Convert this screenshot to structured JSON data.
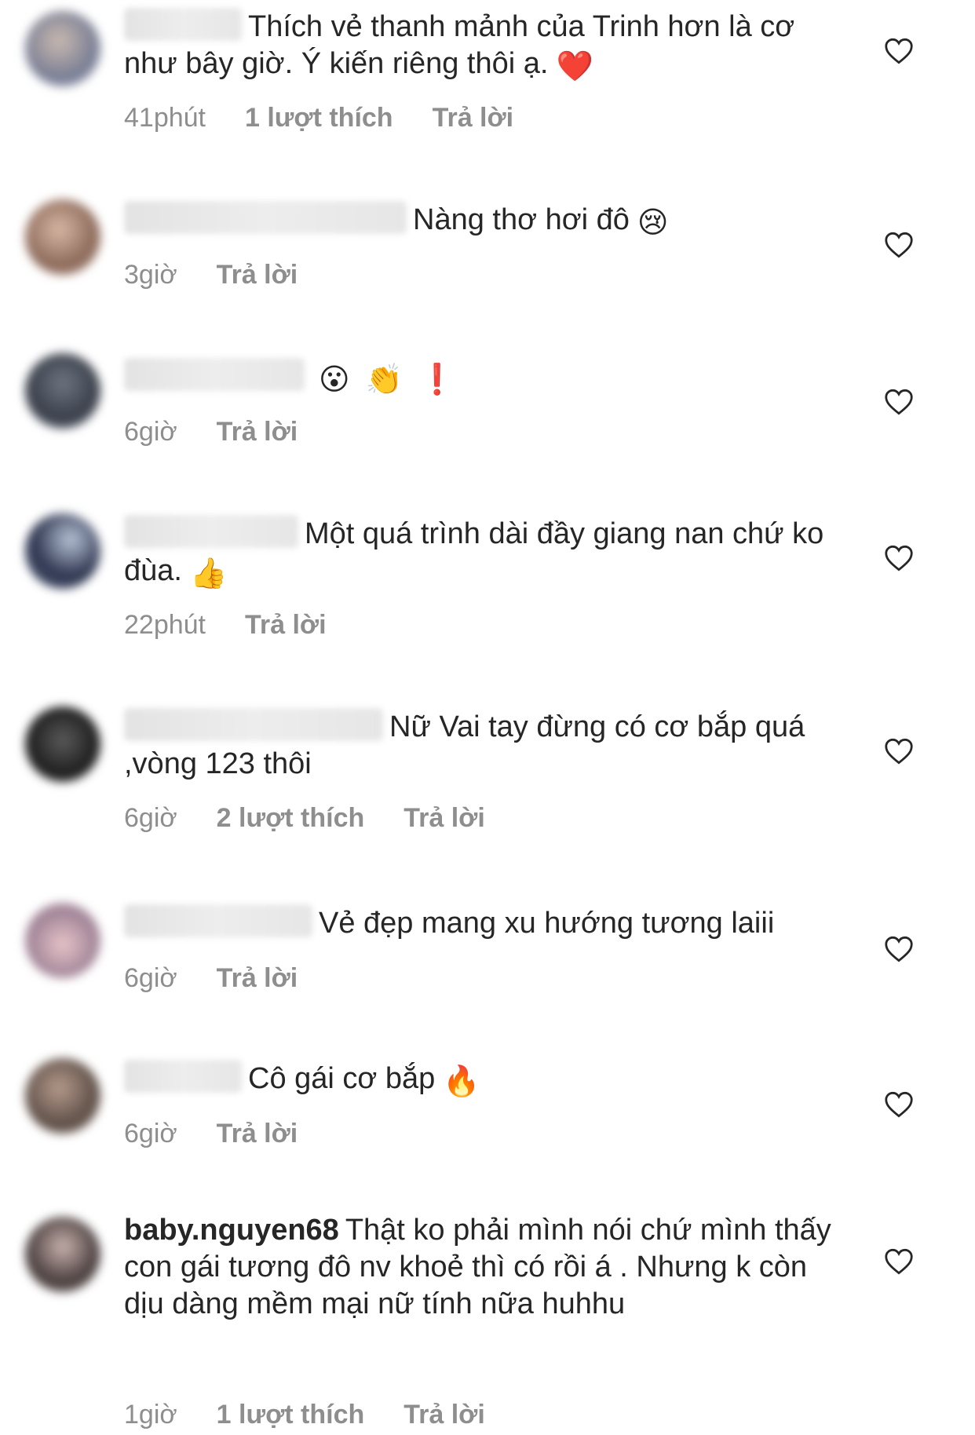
{
  "colors": {
    "text": "#262626",
    "meta": "#8e8e8e",
    "heart_outline": "#262626"
  },
  "comments": [
    {
      "username": "",
      "username_visible": false,
      "text": "Thích vẻ thanh mảnh của Trinh hơn là cơ như bây giờ. Ý kiến riêng thôi ạ.",
      "emoji": "❤️",
      "time": "41phút",
      "likes": "1 lượt thích",
      "reply": "Trả lời"
    },
    {
      "username": "",
      "username_visible": false,
      "text": "Nàng thơ hơi đô",
      "emoji": "😢",
      "time": "3giờ",
      "likes": "",
      "reply": "Trả lời"
    },
    {
      "username": "",
      "username_visible": false,
      "text": "",
      "emoji": "😮 👏 ❗",
      "time": "6giờ",
      "likes": "",
      "reply": "Trả lời"
    },
    {
      "username": "",
      "username_visible": false,
      "text": "Một quá trình dài đầy giang nan chứ ko đùa.",
      "emoji": "👍",
      "time": "22phút",
      "likes": "",
      "reply": "Trả lời"
    },
    {
      "username": "",
      "username_visible": false,
      "text": "Nữ Vai tay đừng có cơ bắp quá ,vòng 123 thôi",
      "emoji": "",
      "time": "6giờ",
      "likes": "2 lượt thích",
      "reply": "Trả lời"
    },
    {
      "username": "",
      "username_visible": false,
      "text": "Vẻ đẹp mang xu hướng tương laiii",
      "emoji": "",
      "time": "6giờ",
      "likes": "",
      "reply": "Trả lời"
    },
    {
      "username": "",
      "username_visible": false,
      "text": "Cô gái cơ bắp",
      "emoji": "🔥",
      "time": "6giờ",
      "likes": "",
      "reply": "Trả lời"
    },
    {
      "username": "baby.nguyen68",
      "username_visible": true,
      "text": "Thật ko phải mình nói chứ mình thấy con gái tương đô nv khoẻ thì có rồi á . Nhưng k còn dịu dàng mềm mại nữ tính nữa huhhu",
      "emoji": "",
      "time": "1giờ",
      "likes": "1 lượt thích",
      "reply": "Trả lời"
    }
  ]
}
